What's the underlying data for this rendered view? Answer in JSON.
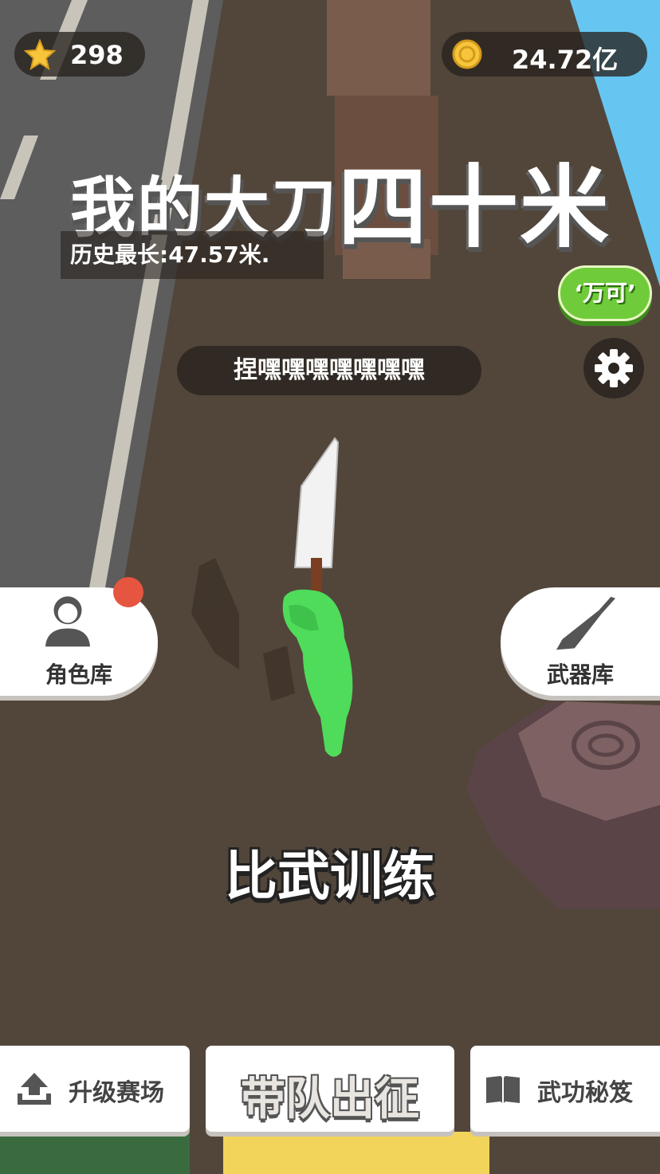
{
  "hud": {
    "stars": "298",
    "coins": "24.72亿"
  },
  "title": {
    "part1": "我的大刀",
    "part2": "四十米"
  },
  "record": "历史最长:47.57米.",
  "ticker": "捏嘿嘿嘿嘿嘿嘿嘿",
  "wanke_button": "‘万可’",
  "side": {
    "roles_label": "角色库",
    "weapons_label": "武器库"
  },
  "mode_title": "比武训练",
  "bottom": {
    "upgrade": "升级赛场",
    "lead": "带队出征",
    "manual": "武功秘笈"
  },
  "colors": {
    "ground": "#4f4338",
    "road": "#5b5b5b",
    "sky": "#66c6f1",
    "player": "#4fdc5a",
    "accent_green": "#6fcb3a",
    "notification": "#e6553f"
  }
}
